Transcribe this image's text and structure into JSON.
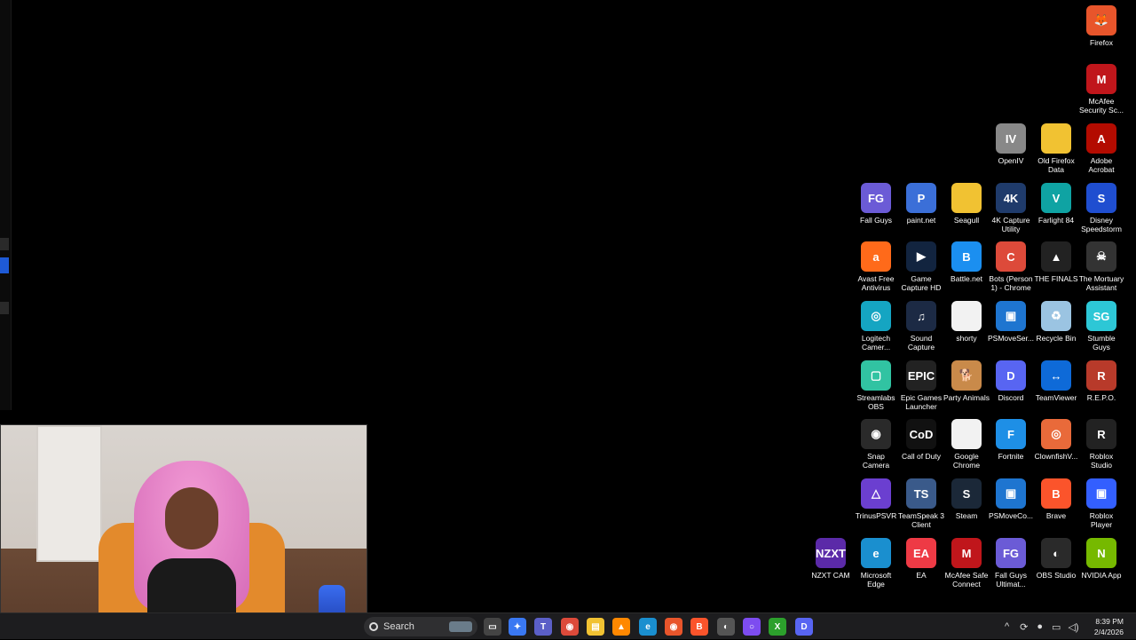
{
  "desktop": {
    "icons": [
      {
        "label": "Firefox",
        "glyph": "🦊",
        "color": "#e8552b"
      },
      {
        "label": "McAfee Security Sc...",
        "glyph": "M",
        "color": "#c0161b"
      },
      {
        "label": "OpenIV",
        "glyph": "IV",
        "color": "#888888"
      },
      {
        "label": "Old Firefox Data",
        "glyph": "",
        "color": "#f1c232"
      },
      {
        "label": "Adobe Acrobat",
        "glyph": "A",
        "color": "#b30b00"
      },
      {
        "label": "Fall Guys",
        "glyph": "FG",
        "color": "#6b5bd6"
      },
      {
        "label": "paint.net",
        "glyph": "P",
        "color": "#3b6fd8"
      },
      {
        "label": "Seagull",
        "glyph": "",
        "color": "#f1c232"
      },
      {
        "label": "4K Capture Utility",
        "glyph": "4K",
        "color": "#1f3b6b"
      },
      {
        "label": "Farlight 84",
        "glyph": "V",
        "color": "#0fa3a3"
      },
      {
        "label": "Disney Speedstorm",
        "glyph": "S",
        "color": "#1f4ed0"
      },
      {
        "label": "Avast Free Antivirus",
        "glyph": "a",
        "color": "#ff6a1a"
      },
      {
        "label": "Game Capture HD",
        "glyph": "▶",
        "color": "#12243f"
      },
      {
        "label": "Battle.net",
        "glyph": "B",
        "color": "#1b8ff0"
      },
      {
        "label": "Bots (Person 1) - Chrome",
        "glyph": "C",
        "color": "#dd4a3a"
      },
      {
        "label": "THE FINALS",
        "glyph": "▲",
        "color": "#222222"
      },
      {
        "label": "The Mortuary Assistant",
        "glyph": "☠",
        "color": "#333333"
      },
      {
        "label": "Logitech Camer...",
        "glyph": "◎",
        "color": "#15a5c2"
      },
      {
        "label": "Sound Capture",
        "glyph": "♫",
        "color": "#1c2a44"
      },
      {
        "label": "shorty",
        "glyph": "",
        "color": "#f2f2f2"
      },
      {
        "label": "PSMoveSer...",
        "glyph": "▣",
        "color": "#1e75d0"
      },
      {
        "label": "Recycle Bin",
        "glyph": "♻",
        "color": "#9bc4e2"
      },
      {
        "label": "Stumble Guys",
        "glyph": "SG",
        "color": "#2dc7d6"
      },
      {
        "label": "Streamlabs OBS",
        "glyph": "▢",
        "color": "#31c3a2"
      },
      {
        "label": "Epic Games Launcher",
        "glyph": "EPIC",
        "color": "#222222"
      },
      {
        "label": "Party Animals",
        "glyph": "🐕",
        "color": "#c98a4a"
      },
      {
        "label": "Discord",
        "glyph": "D",
        "color": "#5865f2"
      },
      {
        "label": "TeamViewer",
        "glyph": "↔",
        "color": "#0e6ad8"
      },
      {
        "label": "R.E.P.O.",
        "glyph": "R",
        "color": "#b83a2a"
      },
      {
        "label": "Snap Camera",
        "glyph": "◉",
        "color": "#2a2a2a"
      },
      {
        "label": "Call of Duty",
        "glyph": "CoD",
        "color": "#111111"
      },
      {
        "label": "Google Chrome",
        "glyph": "",
        "color": "#f2f2f2"
      },
      {
        "label": "Fortnite",
        "glyph": "F",
        "color": "#1e8fe6"
      },
      {
        "label": "ClownfishV...",
        "glyph": "◎",
        "color": "#e96a3a"
      },
      {
        "label": "Roblox Studio",
        "glyph": "R",
        "color": "#222222"
      },
      {
        "label": "TrinusPSVR",
        "glyph": "△",
        "color": "#6b3fd0"
      },
      {
        "label": "TeamSpeak 3 Client",
        "glyph": "TS",
        "color": "#3a5a8a"
      },
      {
        "label": "Steam",
        "glyph": "S",
        "color": "#1b2838"
      },
      {
        "label": "PSMoveCo...",
        "glyph": "▣",
        "color": "#1e75d0"
      },
      {
        "label": "Brave",
        "glyph": "B",
        "color": "#fb542b"
      },
      {
        "label": "Roblox Player",
        "glyph": "▣",
        "color": "#335fff"
      },
      {
        "label": "NZXT CAM",
        "glyph": "NZXT",
        "color": "#5b2aa8"
      },
      {
        "label": "Microsoft Edge",
        "glyph": "e",
        "color": "#1a8fcf"
      },
      {
        "label": "EA",
        "glyph": "EA",
        "color": "#ee3a45"
      },
      {
        "label": "McAfee Safe Connect",
        "glyph": "M",
        "color": "#c0161b"
      },
      {
        "label": "Fall Guys Ultimat...",
        "glyph": "FG",
        "color": "#6b5bd6"
      },
      {
        "label": "OBS Studio",
        "glyph": "◐",
        "color": "#2a2a2a"
      },
      {
        "label": "NVIDIA App",
        "glyph": "N",
        "color": "#76b900"
      }
    ]
  },
  "taskbar": {
    "search_placeholder": "Search",
    "apps": [
      {
        "name": "task-view-icon",
        "glyph": "▭",
        "color": "#444444"
      },
      {
        "name": "copilot-icon",
        "glyph": "✦",
        "color": "#3a78f2"
      },
      {
        "name": "teams-icon",
        "glyph": "T",
        "color": "#5b5fc7"
      },
      {
        "name": "chrome-icon",
        "glyph": "◉",
        "color": "#dd4a3a"
      },
      {
        "name": "file-explorer-icon",
        "glyph": "▤",
        "color": "#f1c232"
      },
      {
        "name": "vlc-icon",
        "glyph": "▲",
        "color": "#ff8800"
      },
      {
        "name": "edge-icon",
        "glyph": "e",
        "color": "#1a8fcf"
      },
      {
        "name": "firefox-icon",
        "glyph": "◉",
        "color": "#e8552b"
      },
      {
        "name": "brave-icon",
        "glyph": "B",
        "color": "#fb542b"
      },
      {
        "name": "obs-icon",
        "glyph": "◐",
        "color": "#555555"
      },
      {
        "name": "app-circle-icon",
        "glyph": "○",
        "color": "#7d4cf0"
      },
      {
        "name": "xbox-icon",
        "glyph": "X",
        "color": "#2ca02c"
      },
      {
        "name": "discord-icon",
        "glyph": "D",
        "color": "#5865f2"
      }
    ],
    "time": "8:39 PM",
    "date": "2/4/2026"
  }
}
